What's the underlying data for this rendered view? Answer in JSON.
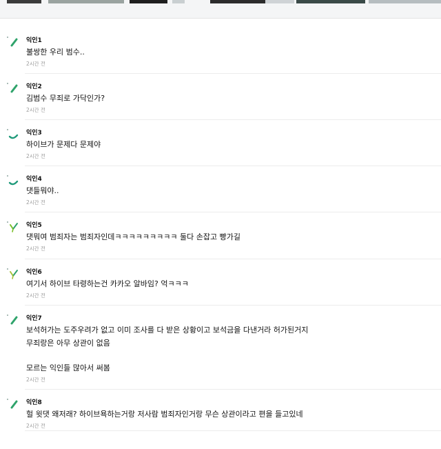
{
  "gallery_strip": [
    {
      "color": "#3b3b3b"
    },
    {
      "color": "#9aa3a0"
    },
    {
      "color": "#1f1f1f"
    },
    {
      "color": "#c9cfd1"
    },
    {
      "color": "#2c2c2c"
    },
    {
      "color": "#cfd3d6"
    },
    {
      "color": "#3a4a48"
    },
    {
      "color": "#b6bdc0"
    }
  ],
  "comments": [
    {
      "author": "익인1",
      "lines": [
        "불쌍한 우리 범수.."
      ],
      "time": "2시간 전",
      "avatar_icon": "green-mark-icon",
      "avatar_color": "#2fa36b"
    },
    {
      "author": "익인2",
      "lines": [
        "김범수 무죄로 가닥인가?"
      ],
      "time": "2시간 전",
      "avatar_icon": "green-mark-icon",
      "avatar_color": "#2fa36b"
    },
    {
      "author": "익인3",
      "lines": [
        "하이브가 문제다 문제야"
      ],
      "time": "2시간 전",
      "avatar_icon": "green-curve-icon",
      "avatar_color": "#1f9a7a"
    },
    {
      "author": "익인4",
      "lines": [
        "댓들뭐야.."
      ],
      "time": "2시간 전",
      "avatar_icon": "green-curve-icon",
      "avatar_color": "#1f9a7a"
    },
    {
      "author": "익인5",
      "lines": [
        "댓뭐여 범죄자는 범죄자인데ㅋㅋㅋㅋㅋㅋㅋㅋㅋ 둘다 손잡고 빵가길"
      ],
      "time": "2시간 전",
      "avatar_icon": "sprout-icon",
      "avatar_color": "#7bbf2a"
    },
    {
      "author": "익인6",
      "lines": [
        "여기서 하이브 타령하는건 카카오 알바임? 억ㅋㅋㅋ"
      ],
      "time": "2시간 전",
      "avatar_icon": "sprout-icon",
      "avatar_color": "#a8c23a"
    },
    {
      "author": "익인7",
      "lines": [
        "보석허가는 도주우려가 없고 이미 조사를 다 받은 상황이고 보석금을 다낸거라 허가된거지",
        "무죄랑은 아무 상관이 없음",
        "",
        "모르는 익인들 많아서 써봄"
      ],
      "time": "2시간 전",
      "avatar_icon": "green-mark-icon",
      "avatar_color": "#2fa36b"
    },
    {
      "author": "익인8",
      "lines": [
        "헐 윗댓 왜저래? 하이브욕하는거랑 저사람 범죄자인거랑 무슨 상관이라고 편을 들고있네"
      ],
      "time": "2시간 전",
      "avatar_icon": "green-mark-icon",
      "avatar_color": "#2fa36b"
    }
  ]
}
